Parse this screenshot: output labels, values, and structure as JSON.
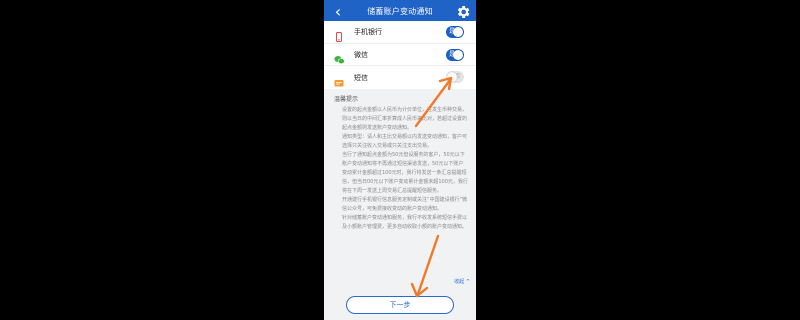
{
  "header": {
    "title": "储蓄账户变动通知",
    "back_icon": "back-arrow-icon",
    "settings_icon": "gear-icon",
    "color": "#1f63c6"
  },
  "channels": [
    {
      "label": "手机银行",
      "icon": "phone-icon",
      "icon_color": "#e0494d",
      "enabled": true,
      "toggle_text": "是"
    },
    {
      "label": "微信",
      "icon": "wechat-icon",
      "icon_color": "#3db43d",
      "enabled": true,
      "toggle_text": "是"
    },
    {
      "label": "短信",
      "icon": "sms-icon",
      "icon_color": "#f39a33",
      "enabled": false,
      "toggle_text": "否"
    }
  ],
  "tips": {
    "heading": "温馨提示",
    "paragraphs": [
      "设置的起点金额以人民币为计价单位，在发生币种交易，则以当日的中间汇率折算成人民币来比对，若超过设置的起点金额则发送账户变动通知。",
      "通知类型：请人和主比交易额以内发送变动通知，客户可选择只关注收入交易或只关注支出交易。",
      "当行了通知起点金额为50元但设服务的客户，50元以下账户变动通知将不再通过短信渠道发送，50元以下账户变动累计金额超过100元时，我行将发送一条汇总提醒短信，但当日00元以下账户变动累计金额未超100元，我行将在下周一发送上周交易汇总提醒短信服务。",
      "开通建行手机银行信息服务定制或关注“中国建设银行”微信公众号，可免费接收变动的账户变动通知。",
      "针对储蓄账户变动通知服务，我行不收发系统短信手费以及小额账户管理费，更多自动收取小额的账户变动通知。"
    ]
  },
  "collapse_label": "收起 ^",
  "next_button_label": "下一步",
  "annotation_color": "#f07a2a"
}
